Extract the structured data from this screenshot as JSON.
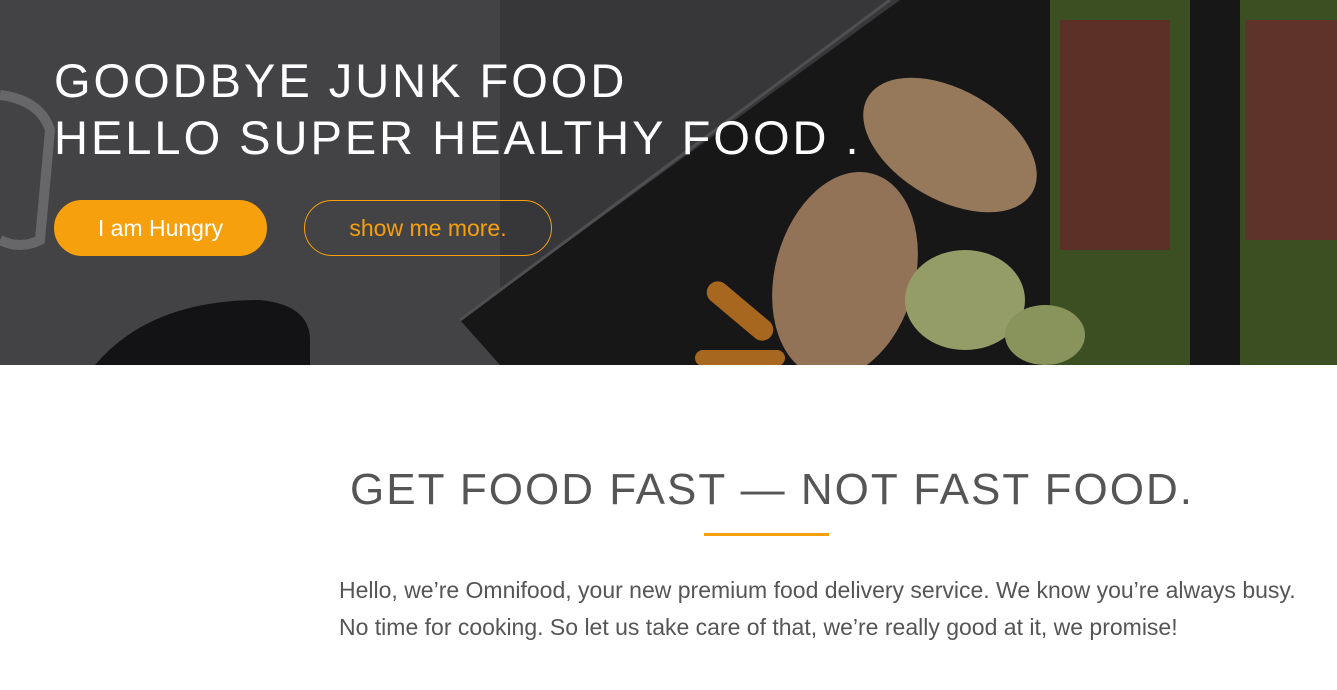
{
  "hero": {
    "title_line1": "GOODBYE JUNK FOOD",
    "title_line2": "HELLO SUPER HEALTHY FOOD .",
    "primary_button": "I am Hungry",
    "secondary_button": "show me more."
  },
  "features": {
    "heading": "GET FOOD FAST — NOT FAST FOOD.",
    "intro": "Hello, we’re Omnifood, your new premium food delivery service. We know you’re always busy. No time for cooking. So let us take care of that, we’re really good at it, we promise!"
  },
  "colors": {
    "accent": "#f7a00d",
    "text": "#555555",
    "hero_overlay": "#2e2e30"
  }
}
